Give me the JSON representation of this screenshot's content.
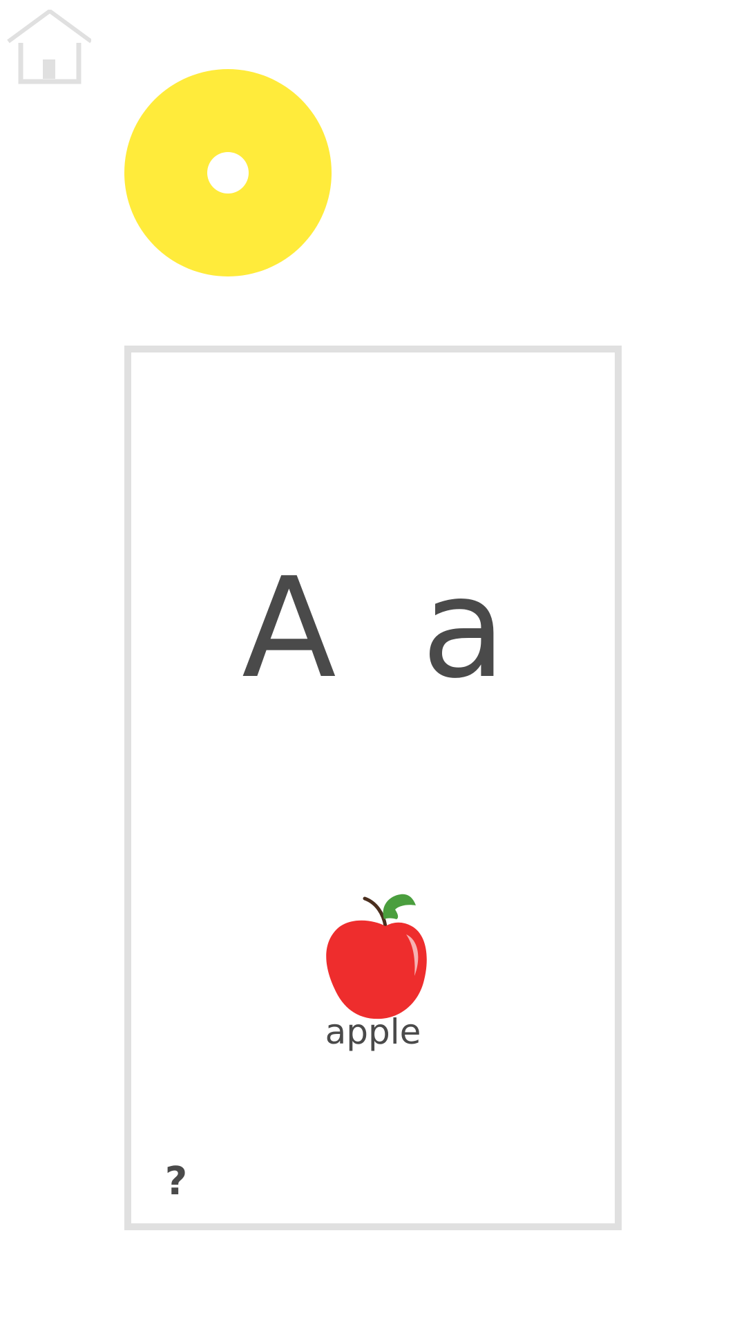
{
  "card": {
    "uppercase": "A",
    "lowercase": "a",
    "word": "apple",
    "help_label": "?"
  },
  "icons": {
    "home": "home-icon",
    "sound": "speaker-icon",
    "picture": "apple-icon",
    "help": "question-mark-icon"
  },
  "colors": {
    "background": "#ffffff",
    "sound_button": "#ffeb3b",
    "card_border": "#e0e0e0",
    "text": "#4a4a4a",
    "apple_red": "#ee2d2d",
    "apple_leaf": "#4a9e3e"
  }
}
